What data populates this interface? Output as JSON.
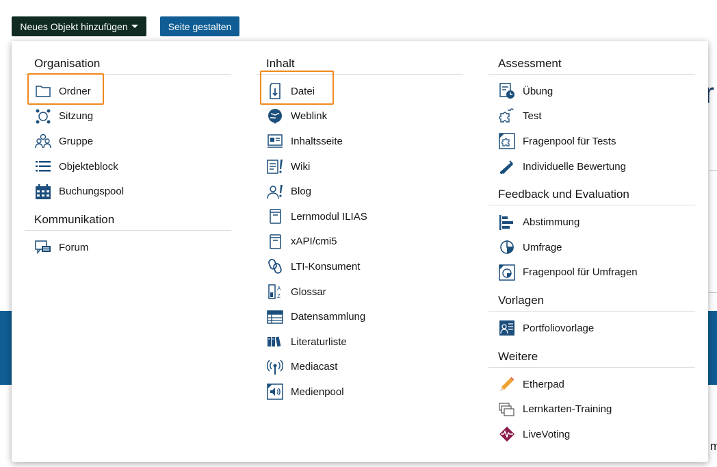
{
  "toolbar": {
    "add_label": "Neues Objekt hinzufügen",
    "design_label": "Seite gestalten"
  },
  "background": {
    "letter_r": "r",
    "letter_m": "m"
  },
  "colors": {
    "primary_blue": "#0f5d94",
    "dark_button": "#0f2b22",
    "highlight": "#f0891e",
    "icon_blue": "#1d4f7c"
  },
  "columns": [
    {
      "groups": [
        {
          "title": "Organisation",
          "items": [
            {
              "label": "Ordner",
              "icon": "folder-icon"
            },
            {
              "label": "Sitzung",
              "icon": "session-icon"
            },
            {
              "label": "Gruppe",
              "icon": "group-icon"
            },
            {
              "label": "Objekteblock",
              "icon": "list-icon"
            },
            {
              "label": "Buchungspool",
              "icon": "calendar-icon"
            }
          ]
        },
        {
          "title": "Kommunikation",
          "items": [
            {
              "label": "Forum",
              "icon": "forum-icon"
            }
          ]
        }
      ]
    },
    {
      "groups": [
        {
          "title": "Inhalt",
          "items": [
            {
              "label": "Datei",
              "icon": "file-icon"
            },
            {
              "label": "Weblink",
              "icon": "weblink-icon"
            },
            {
              "label": "Inhaltsseite",
              "icon": "content-page-icon"
            },
            {
              "label": "Wiki",
              "icon": "wiki-icon"
            },
            {
              "label": "Blog",
              "icon": "blog-icon"
            },
            {
              "label": "Lernmodul ILIAS",
              "icon": "learning-module-icon"
            },
            {
              "label": "xAPI/cmi5",
              "icon": "xapi-icon"
            },
            {
              "label": "LTI-Konsument",
              "icon": "lti-icon"
            },
            {
              "label": "Glossar",
              "icon": "glossary-icon"
            },
            {
              "label": "Datensammlung",
              "icon": "data-collection-icon"
            },
            {
              "label": "Literaturliste",
              "icon": "bibliography-icon"
            },
            {
              "label": "Mediacast",
              "icon": "mediacast-icon"
            },
            {
              "label": "Medienpool",
              "icon": "media-pool-icon"
            }
          ]
        }
      ]
    },
    {
      "groups": [
        {
          "title": "Assessment",
          "items": [
            {
              "label": "Übung",
              "icon": "exercise-icon"
            },
            {
              "label": "Test",
              "icon": "test-icon"
            },
            {
              "label": "Fragenpool für Tests",
              "icon": "question-pool-icon"
            },
            {
              "label": "Individuelle Bewertung",
              "icon": "individual-assessment-icon"
            }
          ]
        },
        {
          "title": "Feedback und Evaluation",
          "items": [
            {
              "label": "Abstimmung",
              "icon": "poll-icon"
            },
            {
              "label": "Umfrage",
              "icon": "survey-icon"
            },
            {
              "label": "Fragenpool für Umfragen",
              "icon": "survey-pool-icon"
            }
          ]
        },
        {
          "title": "Vorlagen",
          "items": [
            {
              "label": "Portfoliovorlage",
              "icon": "portfolio-template-icon"
            }
          ]
        },
        {
          "title": "Weitere",
          "items": [
            {
              "label": "Etherpad",
              "icon": "etherpad-icon"
            },
            {
              "label": "Lernkarten-Training",
              "icon": "flashcards-icon"
            },
            {
              "label": "LiveVoting",
              "icon": "livevoting-icon"
            }
          ]
        }
      ]
    }
  ]
}
